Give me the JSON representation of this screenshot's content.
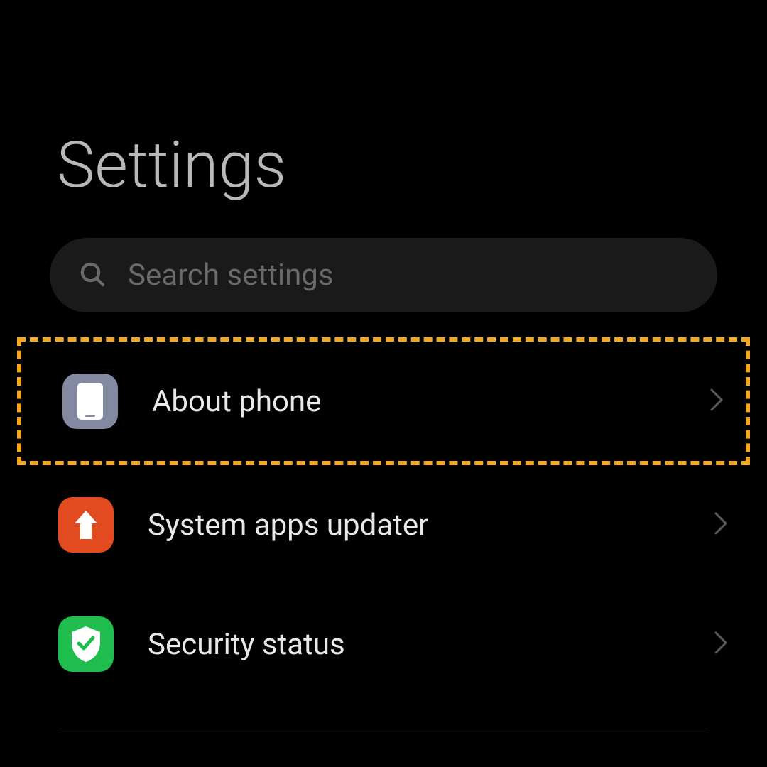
{
  "header": {
    "title": "Settings"
  },
  "search": {
    "placeholder": "Search settings"
  },
  "items": [
    {
      "label": "About phone"
    },
    {
      "label": "System apps updater"
    },
    {
      "label": "Security status"
    }
  ]
}
